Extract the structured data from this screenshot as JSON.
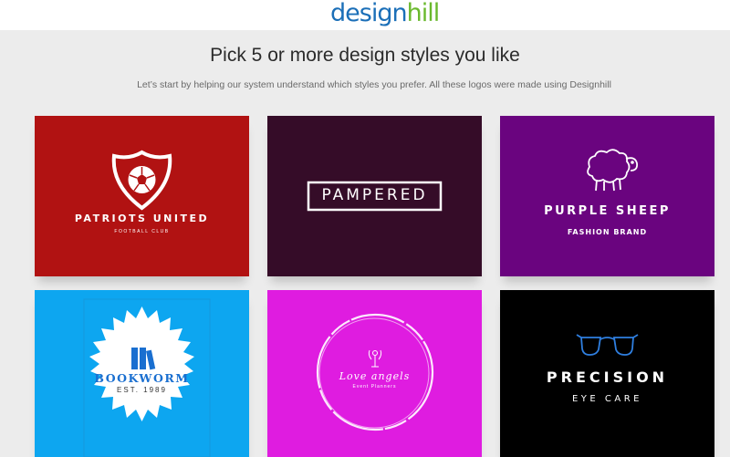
{
  "header": {
    "logo_part1": "design",
    "logo_part2": "hill"
  },
  "main": {
    "title": "Pick 5 or more design styles you like",
    "subtitle": "Let’s start by helping our system understand which styles you prefer. All these logos were made using Designhill"
  },
  "cards": [
    {
      "name": "PATRIOTS UNITED",
      "tagline": "FOOTBALL CLUB",
      "bg": "#b11212",
      "icon": "soccer-shield"
    },
    {
      "name": "PAMPERED",
      "bg": "#350c28",
      "icon": "none"
    },
    {
      "name": "PURPLE SHEEP",
      "tagline": "FASHION BRAND",
      "bg": "#6a047f",
      "icon": "sheep"
    },
    {
      "name": "BOOKWORM",
      "tagline": "EST. 1989",
      "bg": "#0da6f0",
      "icon": "books"
    },
    {
      "name": "Love angels",
      "tagline": "Event Planners",
      "bg": "#df1ce0",
      "icon": "angel"
    },
    {
      "name": "PRECISION",
      "tagline": "EYE CARE",
      "bg": "#000000",
      "icon": "glasses"
    }
  ],
  "colors": {
    "page_bg": "#ececec",
    "brand_blue": "#1b6fb8",
    "brand_green": "#6ab92d",
    "bookworm_blue": "#1a6fd0",
    "glasses_blue": "#2f7fe0"
  }
}
